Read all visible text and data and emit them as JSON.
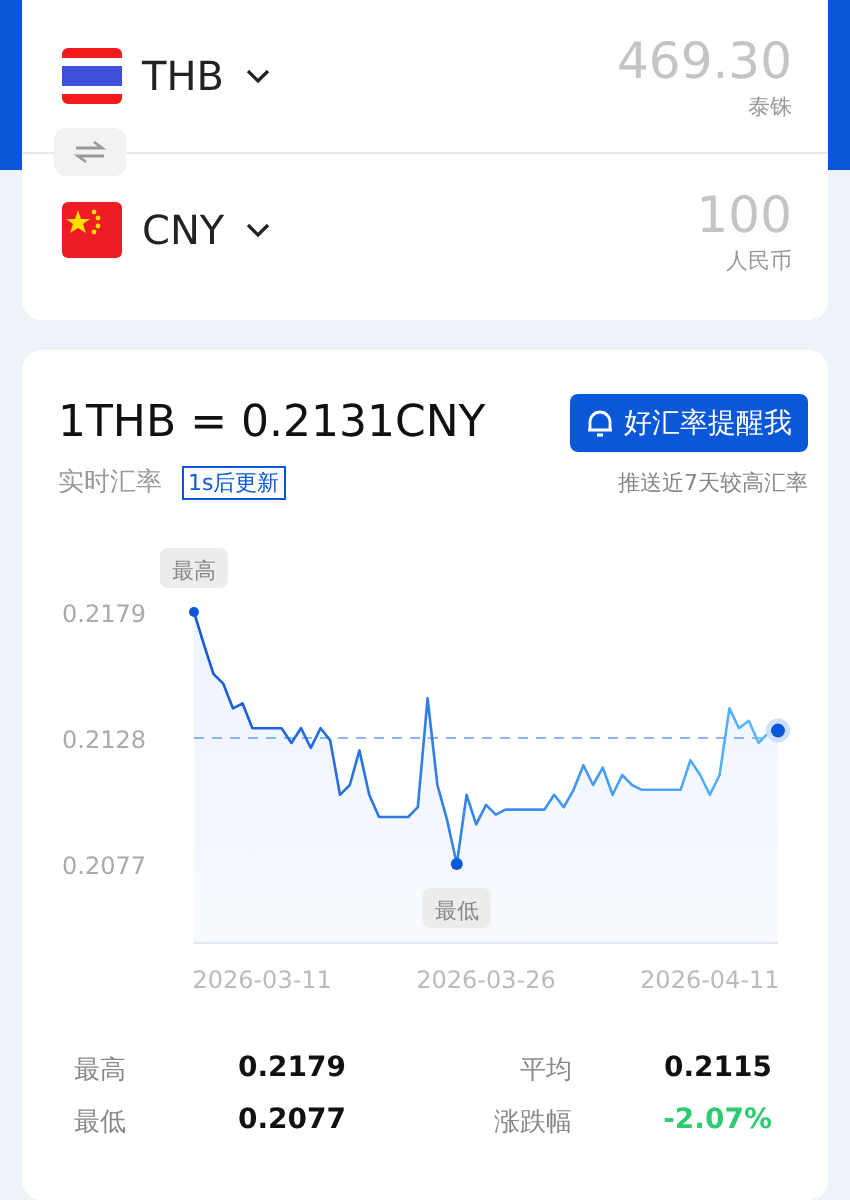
{
  "converter": {
    "rows": [
      {
        "kind": "thailand",
        "code": "THB",
        "amount": "469.30",
        "currency_name": "泰铢"
      },
      {
        "kind": "china",
        "code": "CNY",
        "amount": "100",
        "currency_name": "人民币"
      }
    ]
  },
  "rate": {
    "title": "1THB = 0.2131CNY",
    "alert_button": "好汇率提醒我",
    "label": "实时汇率",
    "update_badge": "1s后更新",
    "note": "推送近7天较高汇率"
  },
  "chart": {
    "chart_data": {
      "type": "area",
      "ylim": [
        0.2045,
        0.2179
      ],
      "yticks": [
        0.2077,
        0.2128,
        0.2179
      ],
      "categories": [
        null,
        null,
        null,
        null,
        null,
        null,
        null,
        "2026-03-11",
        null,
        null,
        null,
        null,
        null,
        null,
        null,
        null,
        null,
        null,
        null,
        null,
        null,
        null,
        null,
        null,
        null,
        null,
        null,
        null,
        null,
        null,
        "2026-03-26",
        null,
        null,
        null,
        null,
        null,
        null,
        null,
        null,
        null,
        null,
        null,
        null,
        null,
        null,
        null,
        null,
        null,
        null,
        null,
        null,
        null,
        null,
        "2026-04-11",
        null,
        null,
        null,
        null,
        null,
        null,
        null
      ],
      "values": [
        0.2179,
        0.2166,
        0.2154,
        0.215,
        0.214,
        0.2142,
        0.2132,
        0.2132,
        0.2132,
        0.2132,
        0.2126,
        0.2132,
        0.2124,
        0.2132,
        0.2127,
        0.2105,
        0.2109,
        0.2123,
        0.2105,
        0.2096,
        0.2096,
        0.2096,
        0.2096,
        0.21,
        0.2144,
        0.2109,
        0.2095,
        0.2077,
        0.2105,
        0.2093,
        0.2101,
        0.2097,
        0.2099,
        0.2099,
        0.2099,
        0.2099,
        0.2099,
        0.2105,
        0.21,
        0.2107,
        0.2117,
        0.2109,
        0.2116,
        0.2105,
        0.2113,
        0.2109,
        0.2107,
        0.2107,
        0.2107,
        0.2107,
        0.2107,
        0.2119,
        0.2113,
        0.2105,
        0.2113,
        0.214,
        0.2132,
        0.2135,
        0.2126,
        0.213,
        0.2131
      ],
      "annotations": [
        {
          "text": "最高"
        },
        {
          "text": "最低"
        }
      ],
      "ref_lines": [
        {
          "axis": "y",
          "value": 0.2128
        }
      ]
    }
  },
  "stats": [
    {
      "label": "最高",
      "value": "0.2179",
      "color": "#111111"
    },
    {
      "label": "平均",
      "value": "0.2115",
      "color": "#111111"
    },
    {
      "label": "最低",
      "value": "0.2077",
      "color": "#111111"
    },
    {
      "label": "涨跌幅",
      "value": "-2.07%",
      "color": "#2ecc71"
    }
  ]
}
